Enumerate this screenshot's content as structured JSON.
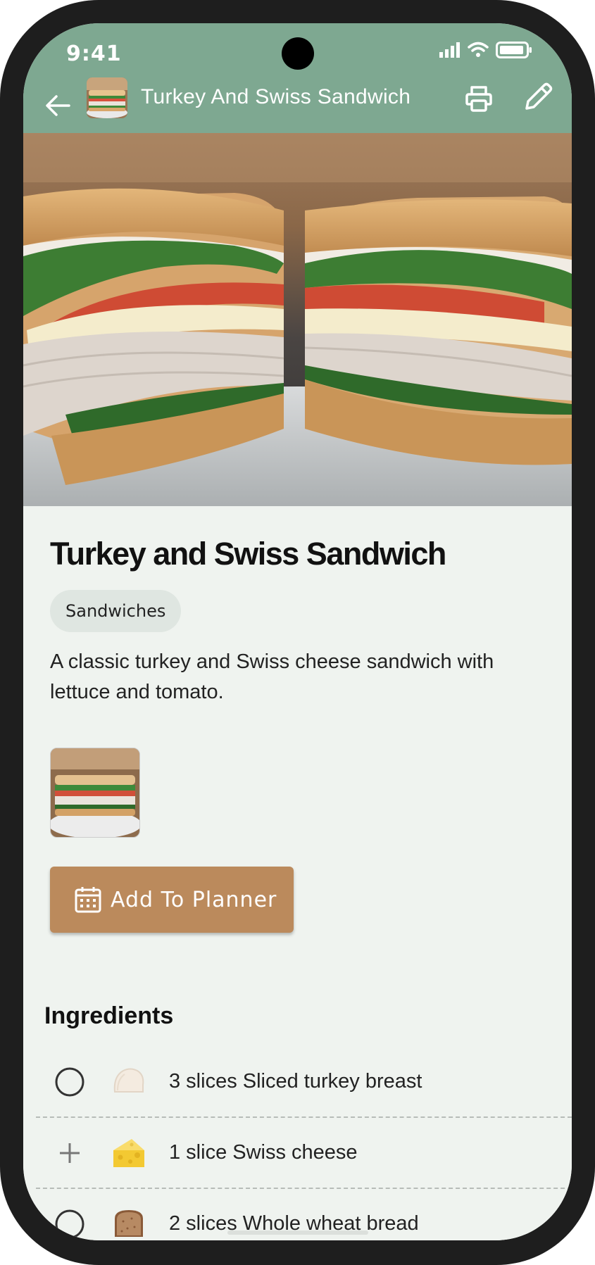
{
  "status_bar": {
    "time": "9:41"
  },
  "app_bar": {
    "title": "Turkey And Swiss Sandwich",
    "back_icon": "arrow-left-icon",
    "print_icon": "printer-icon",
    "edit_icon": "pencil-icon"
  },
  "recipe": {
    "title": "Turkey and Swiss Sandwich",
    "category": "Sandwiches",
    "description": "A classic turkey and Swiss cheese sandwich with lettuce and tomato."
  },
  "actions": {
    "add_to_planner_label": "Add To Planner",
    "planner_icon": "calendar-icon"
  },
  "ingredients": {
    "heading": "Ingredients",
    "items": [
      {
        "text": "3 slices Sliced turkey breast",
        "toggle": "circle",
        "icon": "turkey-slice-icon"
      },
      {
        "text": "1 slice Swiss cheese",
        "toggle": "plus",
        "icon": "cheese-icon"
      },
      {
        "text": "2 slices Whole wheat bread",
        "toggle": "circle",
        "icon": "bread-icon"
      }
    ]
  },
  "colors": {
    "app_bar": "#7ea891",
    "background": "#eff3ef",
    "button": "#bb8a5c",
    "chip": "#dfe6e1"
  }
}
